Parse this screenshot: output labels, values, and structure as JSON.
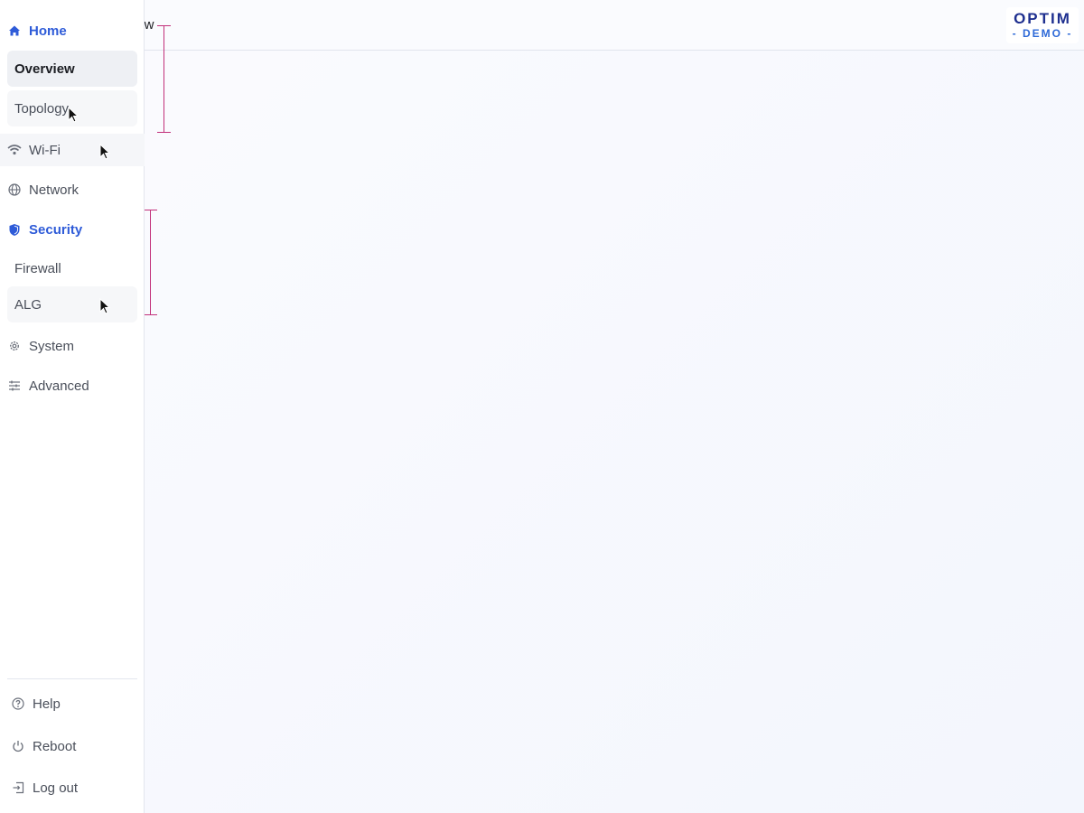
{
  "header": {
    "page_title": "Overview",
    "logo_top": "OPTIM",
    "logo_bottom": "- DEMO -"
  },
  "sidebar": {
    "sections": [
      {
        "label": "Home",
        "icon": "home-icon",
        "active": true
      },
      {
        "label": "Wi-Fi",
        "icon": "wifi-icon",
        "active": false
      },
      {
        "label": "Network",
        "icon": "globe-icon",
        "active": false
      },
      {
        "label": "Security",
        "icon": "shield-icon",
        "active": true
      },
      {
        "label": "System",
        "icon": "gear-icon",
        "active": false
      },
      {
        "label": "Advanced",
        "icon": "sliders-icon",
        "active": false
      }
    ],
    "home_items": [
      {
        "label": "Overview",
        "selected": true
      },
      {
        "label": "Topology",
        "selected": false
      }
    ],
    "security_items": [
      {
        "label": "Firewall"
      },
      {
        "label": "ALG"
      }
    ],
    "bottom": [
      {
        "label": "Help",
        "icon": "help-circle-icon"
      },
      {
        "label": "Reboot",
        "icon": "power-icon"
      },
      {
        "label": "Log out",
        "icon": "logout-icon"
      }
    ]
  },
  "colors": {
    "accent": "#2e5bd8",
    "logo_dark": "#1e2f8f",
    "marker": "#c2307a"
  }
}
